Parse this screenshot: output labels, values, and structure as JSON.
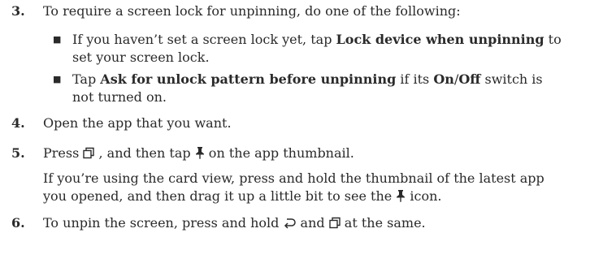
{
  "steps": {
    "s3": {
      "number": "3.",
      "text": "To require a screen lock for unpinning, do one of the following:"
    },
    "b1": {
      "l1_pre": "If you haven’t set a screen lock yet, tap ",
      "l1_bold": "Lock device when unpinning",
      "l1_post": " to",
      "l2": "set your screen lock."
    },
    "b2": {
      "l1_pre": "Tap ",
      "l1_bold1": "Ask for unlock pattern before unpinning",
      "l1_mid": " if its ",
      "l1_bold2": "On",
      "l1_slash": "/",
      "l1_bold3": "Off",
      "l1_post": " switch is",
      "l2": "not turned on."
    },
    "s4": {
      "number": "4.",
      "text": "Open the app that you want."
    },
    "s5": {
      "number": "5.",
      "pre": "Press ",
      "mid": " , and then tap ",
      "post": " on the app thumbnail.",
      "note_l1": "If you’re using the card view, press and hold the thumbnail of the latest app",
      "note_l2_pre": "you opened, and then drag it up a little bit to see the ",
      "note_l2_post": " icon."
    },
    "s6": {
      "number": "6.",
      "pre": "To unpin the screen, press and hold ",
      "mid": " and ",
      "post": " at the same."
    }
  },
  "bullet_glyph": "■",
  "icons": {
    "recent_apps": "recent-apps-icon",
    "pin": "pin-icon",
    "back": "back-icon"
  }
}
